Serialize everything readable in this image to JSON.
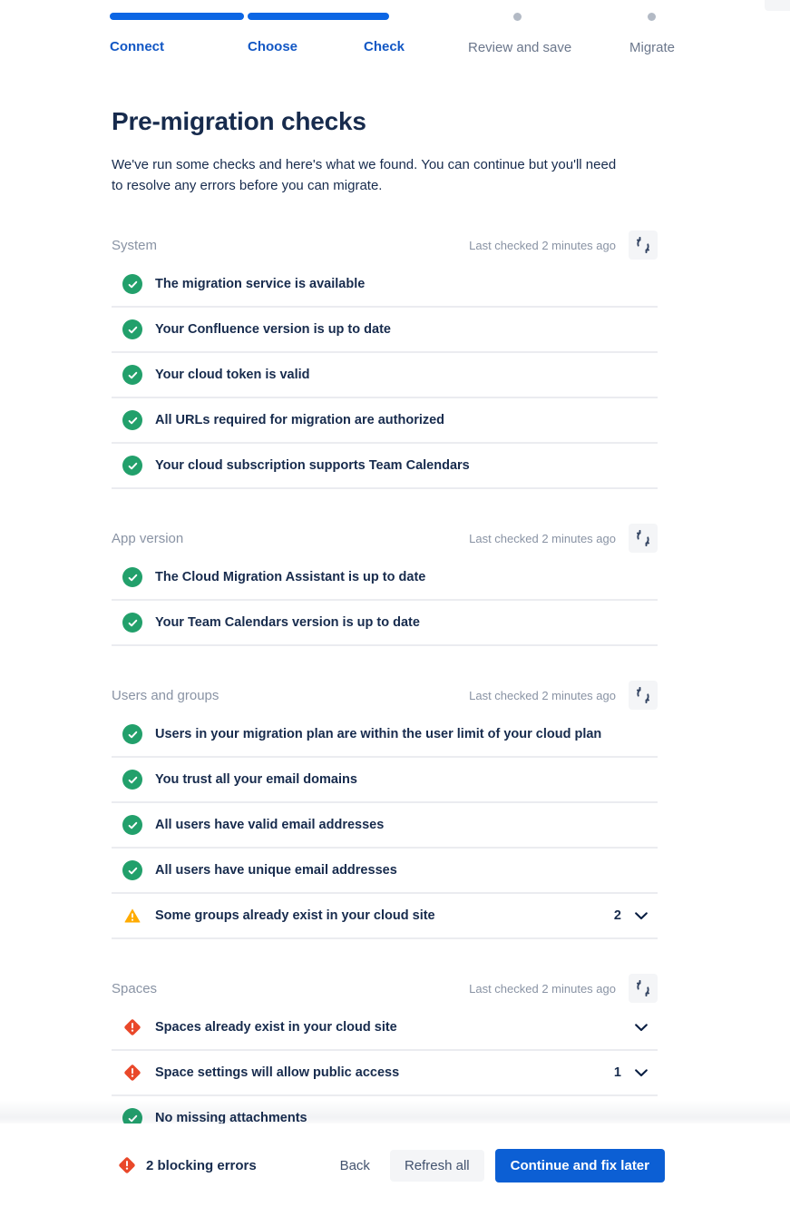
{
  "stepper": {
    "steps": [
      {
        "label": "Connect",
        "state": "done"
      },
      {
        "label": "Choose",
        "state": "done"
      },
      {
        "label": "Check",
        "state": "current"
      },
      {
        "label": "Review and save",
        "state": "todo"
      },
      {
        "label": "Migrate",
        "state": "todo"
      }
    ],
    "accent_color": "#0c66e4",
    "todo_dot_color": "#b3bac5"
  },
  "page": {
    "title": "Pre-migration checks",
    "subtitle": "We've run some checks and here's what we found. You can continue but you'll need to resolve any errors before you can migrate."
  },
  "sections": [
    {
      "name": "System",
      "last_checked": "Last checked 2 minutes ago",
      "refresh_icon": "refresh-icon",
      "rows": [
        {
          "status": "success",
          "icon": "check-circle-icon",
          "label": "The migration service is available",
          "count": "",
          "chevron": false
        },
        {
          "status": "success",
          "icon": "check-circle-icon",
          "label": "Your Confluence version is up to date",
          "count": "",
          "chevron": false
        },
        {
          "status": "success",
          "icon": "check-circle-icon",
          "label": "Your cloud token is valid",
          "count": "",
          "chevron": false
        },
        {
          "status": "success",
          "icon": "check-circle-icon",
          "label": "All URLs required for migration are authorized",
          "count": "",
          "chevron": false
        },
        {
          "status": "success",
          "icon": "check-circle-icon",
          "label": "Your cloud subscription supports Team Calendars",
          "count": "",
          "chevron": false
        }
      ]
    },
    {
      "name": "App version",
      "last_checked": "Last checked 2 minutes ago",
      "refresh_icon": "refresh-icon",
      "rows": [
        {
          "status": "success",
          "icon": "check-circle-icon",
          "label": "The Cloud Migration Assistant is up to date",
          "count": "",
          "chevron": false
        },
        {
          "status": "success",
          "icon": "check-circle-icon",
          "label": "Your Team Calendars version is up to date",
          "count": "",
          "chevron": false
        }
      ]
    },
    {
      "name": "Users and groups",
      "last_checked": "Last checked 2 minutes ago",
      "refresh_icon": "refresh-icon",
      "rows": [
        {
          "status": "success",
          "icon": "check-circle-icon",
          "label": "Users in your migration plan are within the user limit of your cloud plan",
          "count": "",
          "chevron": false
        },
        {
          "status": "success",
          "icon": "check-circle-icon",
          "label": "You trust all your email domains",
          "count": "",
          "chevron": false
        },
        {
          "status": "success",
          "icon": "check-circle-icon",
          "label": "All users have valid email addresses",
          "count": "",
          "chevron": false
        },
        {
          "status": "success",
          "icon": "check-circle-icon",
          "label": "All users have unique email addresses",
          "count": "",
          "chevron": false
        },
        {
          "status": "warning",
          "icon": "warning-triangle-icon",
          "label": "Some groups already exist in your cloud site",
          "count": "2",
          "chevron": true
        }
      ]
    },
    {
      "name": "Spaces",
      "last_checked": "Last checked 2 minutes ago",
      "refresh_icon": "refresh-icon",
      "rows": [
        {
          "status": "error",
          "icon": "error-diamond-icon",
          "label": "Spaces already exist in your cloud site",
          "count": "",
          "chevron": true
        },
        {
          "status": "error",
          "icon": "error-diamond-icon",
          "label": "Space settings will allow public access",
          "count": "1",
          "chevron": true
        },
        {
          "status": "success",
          "icon": "check-circle-icon",
          "label": "No missing attachments",
          "count": "",
          "chevron": false
        }
      ]
    }
  ],
  "footer": {
    "blocking_icon": "error-diamond-icon",
    "blocking_text": "2 blocking errors",
    "back_label": "Back",
    "refresh_all_label": "Refresh all",
    "continue_label": "Continue and fix later"
  },
  "colors": {
    "success": "#22a06b",
    "warning": "#ffab00",
    "error": "#e9482a",
    "primary": "#0c5fd4",
    "text": "#172b4d",
    "muted": "#8993a4"
  }
}
